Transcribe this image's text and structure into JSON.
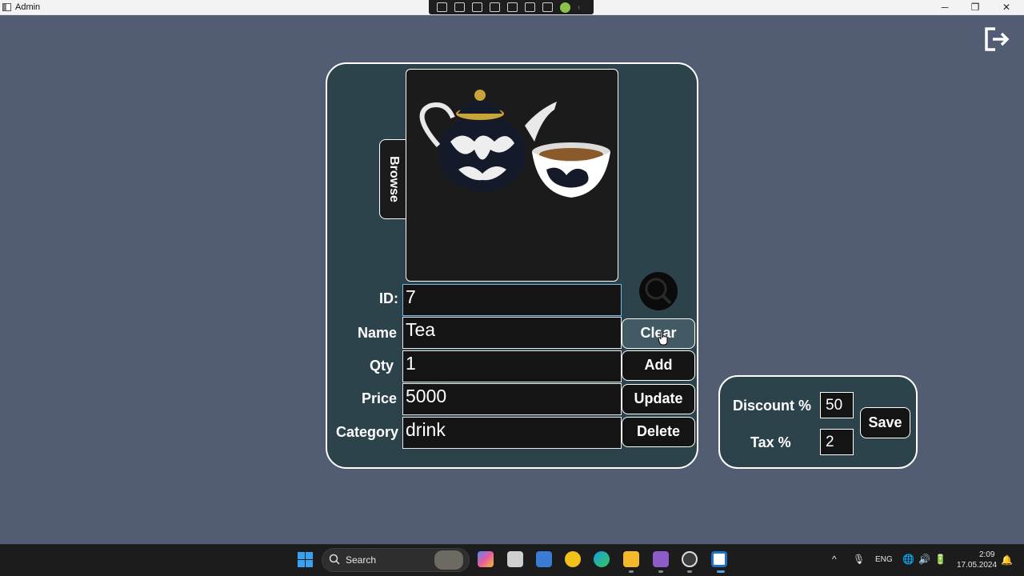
{
  "window": {
    "title": "Admin"
  },
  "form": {
    "image_alt": "Teapot and bowl",
    "browse_label": "Browse",
    "fields": [
      {
        "label": "ID:",
        "value": "7"
      },
      {
        "label": "Name",
        "value": "Tea"
      },
      {
        "label": "Qty",
        "value": "1"
      },
      {
        "label": "Price",
        "value": "5000"
      },
      {
        "label": "Category",
        "value": "drink"
      }
    ],
    "buttons": {
      "clear": "Clear",
      "add": "Add",
      "update": "Update",
      "delete": "Delete"
    }
  },
  "settings": {
    "discount_label": "Discount %",
    "discount_value": "50",
    "tax_label": "Tax %",
    "tax_value": "2",
    "save_label": "Save"
  },
  "taskbar": {
    "search_label": "Search",
    "language": "ENG",
    "time": "2:09",
    "date": "17.05.2024"
  },
  "colors": {
    "background": "#525c73",
    "panel": "#2c434b",
    "input_bg": "#141414",
    "accent_focus": "#7fb7e8"
  }
}
